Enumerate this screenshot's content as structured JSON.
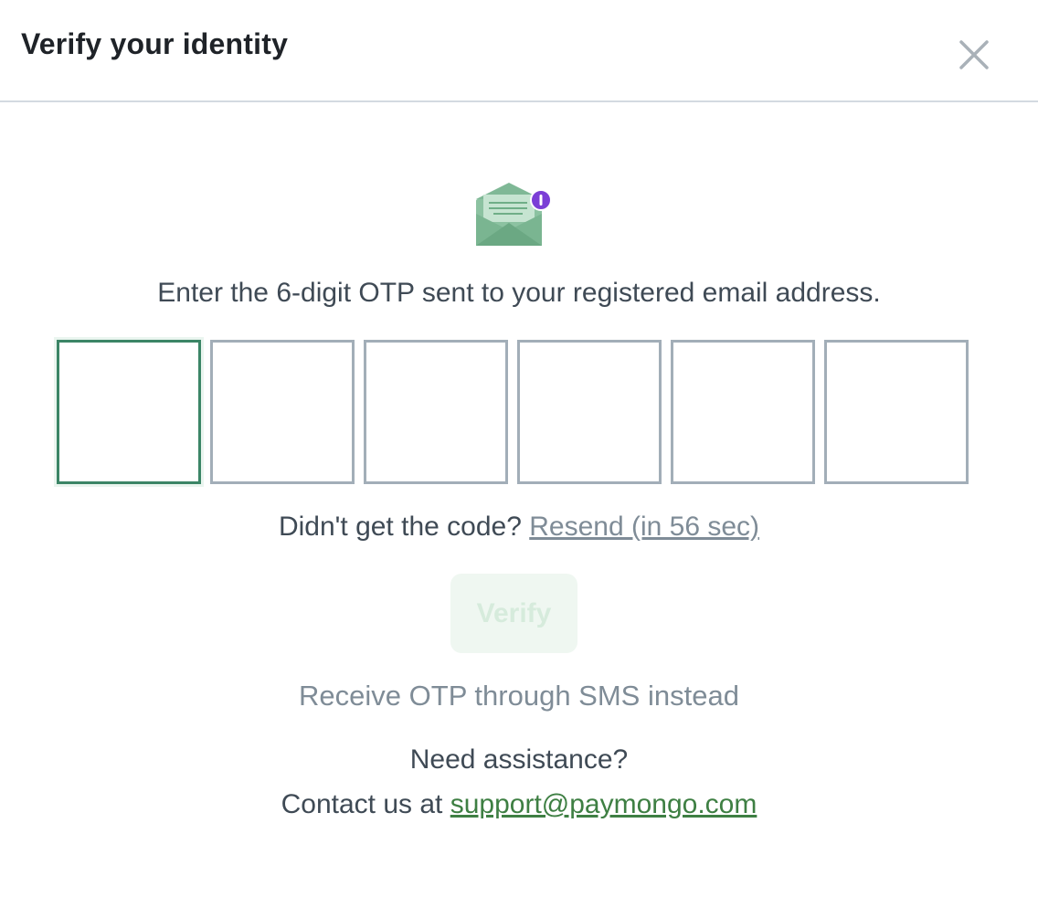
{
  "dialog": {
    "title": "Verify your identity"
  },
  "icons": {
    "close": "close-icon",
    "envelope": "envelope-icon"
  },
  "instruction": "Enter the 6-digit OTP sent to your registered email address.",
  "otp": {
    "digits": [
      "",
      "",
      "",
      "",
      "",
      ""
    ]
  },
  "resend": {
    "prompt": "Didn't get the code?",
    "link_label": "Resend (in 56 sec)"
  },
  "verify": {
    "label": "Verify"
  },
  "sms": {
    "label": "Receive OTP through SMS instead"
  },
  "help": {
    "title": "Need assistance?",
    "contact_prefix": "Contact us at",
    "email": "support@paymongo.com"
  },
  "colors": {
    "active_border": "#3b8566",
    "box_border": "#a2aeb8",
    "link_muted": "#7f8c97",
    "link_green": "#3e7f43",
    "verify_disabled_bg": "#eff7f1",
    "notification_dot": "#7b3fd6"
  }
}
